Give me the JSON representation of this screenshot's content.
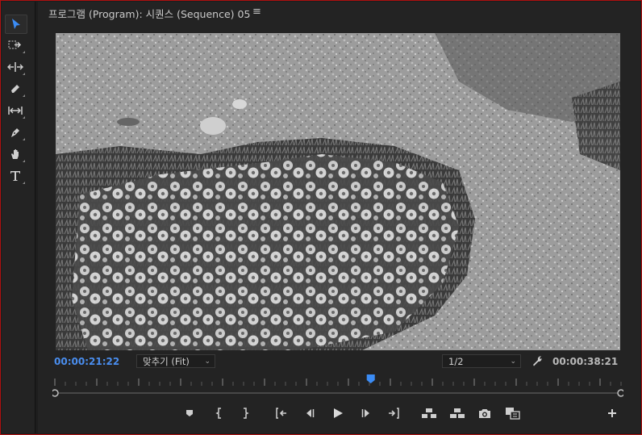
{
  "panel": {
    "title": "프로그램 (Program): 시퀀스 (Sequence) 05",
    "menu_icon": "≡"
  },
  "tools": [
    {
      "name": "selection-tool-icon",
      "active": true
    },
    {
      "name": "track-select-forward-tool-icon",
      "active": false
    },
    {
      "name": "ripple-edit-tool-icon",
      "active": false
    },
    {
      "name": "razor-tool-icon",
      "active": false
    },
    {
      "name": "slip-tool-icon",
      "active": false
    },
    {
      "name": "pen-tool-icon",
      "active": false
    },
    {
      "name": "hand-tool-icon",
      "active": false
    },
    {
      "name": "type-tool-icon",
      "active": false
    }
  ],
  "timecode": {
    "current": "00:00:21:22",
    "duration": "00:00:38:21"
  },
  "zoom": {
    "selected": "맞추기 (Fit)"
  },
  "resolution": {
    "selected": "1/2"
  },
  "playhead_fraction": 0.558,
  "controls": [
    "add-marker-button",
    "mark-in-button",
    "mark-out-button",
    "go-to-in-button",
    "step-back-button",
    "play-button",
    "step-forward-button",
    "go-to-out-button",
    "lift-button",
    "extract-button",
    "export-frame-button",
    "comparison-view-button",
    "add-button"
  ],
  "colors": {
    "accent": "#4a8eef",
    "border": "#b01010"
  }
}
